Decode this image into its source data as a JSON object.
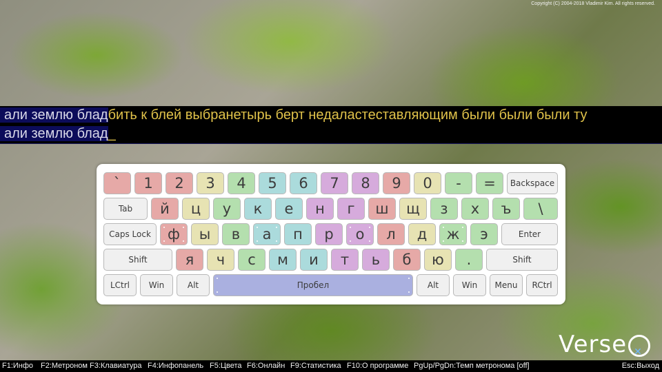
{
  "copyright": "Copyright (C) 2004-2018 Vladimir Kim. All rights reserved.",
  "typing": {
    "line1_typed": "али землю блад",
    "line1_remaining": "бить к блей выбранетырь берт недаластеставляющим были были были ту",
    "line2_typed": "али землю блад",
    "cursor": "_"
  },
  "colors": {
    "red": "#e6a9a7",
    "yellow": "#e7e3b3",
    "green": "#b4dfae",
    "cyan": "#abdbdc",
    "purple": "#d6abdc",
    "gray": "#f0f0f0",
    "space": "#aab0e0"
  },
  "keyboard": {
    "row1": [
      "`",
      "1",
      "2",
      "3",
      "4",
      "5",
      "6",
      "7",
      "8",
      "9",
      "0",
      "-",
      "=",
      "Backspace"
    ],
    "row2": [
      "Tab",
      "й",
      "ц",
      "у",
      "к",
      "е",
      "н",
      "г",
      "ш",
      "щ",
      "з",
      "х",
      "ъ",
      "\\"
    ],
    "row3": [
      "Caps Lock",
      "ф",
      "ы",
      "в",
      "а",
      "п",
      "р",
      "о",
      "л",
      "д",
      "ж",
      "э",
      "Enter"
    ],
    "row4": [
      "Shift",
      "я",
      "ч",
      "с",
      "м",
      "и",
      "т",
      "ь",
      "б",
      "ю",
      ".",
      "Shift"
    ],
    "row5": [
      "LCtrl",
      "Win",
      "Alt",
      "Пробел",
      "Alt",
      "Win",
      "Menu",
      "RCtrl"
    ]
  },
  "logo": {
    "text": "Verse"
  },
  "status_bar": {
    "f1": "F1:Инфо",
    "f2": "F2:Метроном",
    "f3": "F3:Клавиатура",
    "f4": "F4:Инфопанель",
    "f5": "F5:Цвета",
    "f6": "F6:Онлайн",
    "f9": "F9:Статистика",
    "f10": "F10:О программе",
    "pgupdn": "PgUp/PgDn:Темп метронома [off]",
    "esc": "Esc:Выход"
  }
}
